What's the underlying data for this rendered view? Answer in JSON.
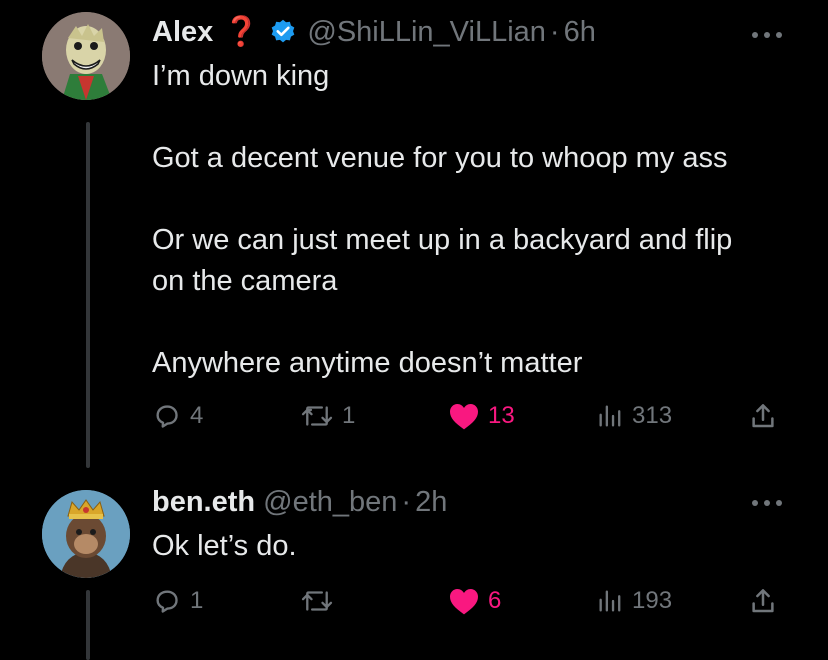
{
  "tweets": [
    {
      "display_name": "Alex",
      "badge": "❓",
      "verified": true,
      "handle": "@ShiLLin_ViLLian",
      "separator": "·",
      "time": "6h",
      "paragraphs": [
        "I’m down king",
        "Got a decent venue for you to whoop my ass",
        "Or we can just meet up in a backyard and flip on the camera",
        "Anywhere anytime doesn’t matter"
      ],
      "stats": {
        "replies": "4",
        "retweets": "1",
        "likes": "13",
        "views": "313"
      },
      "liked": true
    },
    {
      "display_name": "ben.eth",
      "handle": "@eth_ben",
      "separator": "·",
      "time": "2h",
      "paragraphs": [
        "Ok let’s do."
      ],
      "stats": {
        "replies": "1",
        "retweets": "",
        "likes": "6",
        "views": "193"
      },
      "liked": true
    }
  ],
  "colors": {
    "background": "#000000",
    "text": "#e7e9ea",
    "muted": "#71767b",
    "like": "#f91880",
    "verified": "#1d9bf0",
    "badge": "#e0245e"
  },
  "icons": [
    "reply-icon",
    "retweet-icon",
    "heart-icon",
    "views-icon",
    "share-icon",
    "verified-icon",
    "more-icon"
  ]
}
